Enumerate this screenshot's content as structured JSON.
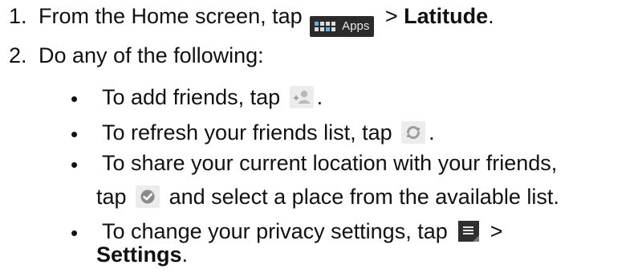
{
  "steps": [
    {
      "number": "1.",
      "text_before": "From the Home screen, tap",
      "apps_label": "Apps",
      "separator": ">",
      "target": "Latitude",
      "end": "."
    },
    {
      "number": "2.",
      "text": "Do any of the following:"
    }
  ],
  "bullets": [
    {
      "text_before": "To add friends, tap",
      "icon": "add-friend-icon",
      "end": "."
    },
    {
      "text_before": "To refresh your friends list, tap",
      "icon": "refresh-icon",
      "end": "."
    },
    {
      "line1": "To share your current location with your friends,",
      "line2_before": "tap",
      "icon": "check-in-icon",
      "line2_after": "and select a place from the available list."
    },
    {
      "text_before": "To change your privacy settings, tap",
      "icon": "menu-icon",
      "separator": ">",
      "target": "Settings",
      "end": "."
    }
  ],
  "bullet_char": "•"
}
